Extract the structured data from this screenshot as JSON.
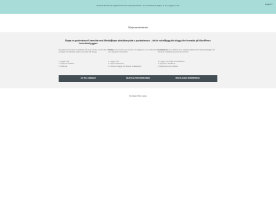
{
  "banner": {
    "text": "Denna domän är registrerad via Loopia Domäner. Om domänens ägare är du, logga in här",
    "link": "Logga in"
  },
  "tabs": {
    "active_label": "Skicja användande"
  },
  "cards": [
    {
      "title": "Skapa en professionell hemsida med Weebly hemsidesbyggare",
      "description": "Nu skapar du hemsidan med Weebly på ett par minuter. Använd dra-och-släpp-verktyget och välj bland mallar som passar ditt företag.",
      "list": [
        "1. Logga in här",
        "2. Välj ett av mallarna",
        "3. Publicera"
      ],
      "button": "GÅ TILL WEEBLY"
    },
    {
      "title": "Skapa skräddarsydda e-postadresser – det är enkelt",
      "description": "Skicka e-post med din egen domän och inlägg med en ny professionell e-postadress som passar din verksamhet.",
      "list": [
        "1. Logga in här",
        "2. Välj e-postadressen",
        "3. Förvara i inloggat och hantera meddelanden"
      ],
      "button": "SKAPA E-POSTADRESSER"
    },
    {
      "title": "Bygg din blogg eller hemsida på WordPress",
      "description": "WordPress är en av världens mest populära plattformar för att skapa bloggar och hemsidor. Installera det enkelt med ett klick.",
      "list": [
        "1. Logga in och börja med WordPress",
        "2. Välj tema i WordPress",
        "3. Börja skriva och publicera"
      ],
      "button": "INSTALLERA WORDPRESS"
    }
  ],
  "footer": {
    "link": "Domänen från Loopia"
  }
}
